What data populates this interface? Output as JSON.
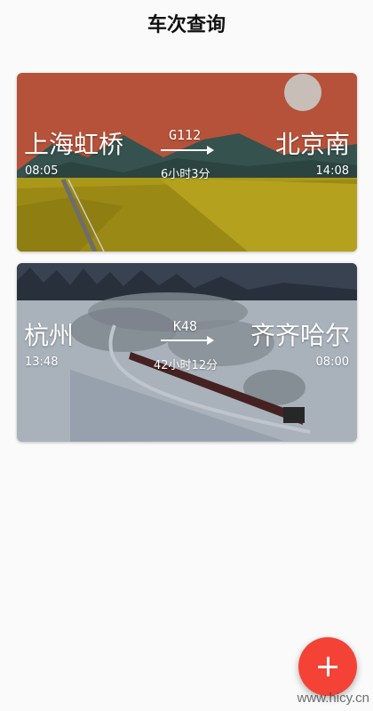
{
  "header": {
    "title": "车次查询"
  },
  "trips": [
    {
      "from": "上海虹桥",
      "to": "北京南",
      "train_no": "G112",
      "depart": "08:05",
      "arrive": "14:08",
      "duration": "6小时3分"
    },
    {
      "from": "杭州",
      "to": "齐齐哈尔",
      "train_no": "K48",
      "depart": "13:48",
      "arrive": "08:00",
      "duration": "42小时12分"
    }
  ],
  "fab": {
    "icon": "plus-icon",
    "color": "#f44336"
  },
  "watermark": "www.hicy.cn"
}
